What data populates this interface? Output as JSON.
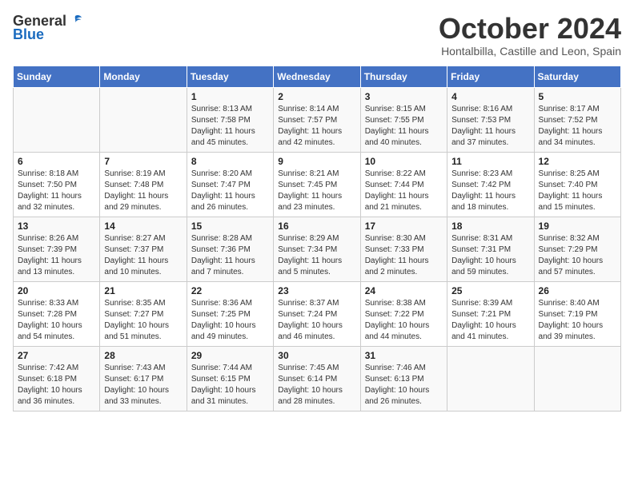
{
  "header": {
    "logo_general": "General",
    "logo_blue": "Blue",
    "month_title": "October 2024",
    "subtitle": "Hontalbilla, Castille and Leon, Spain"
  },
  "days_of_week": [
    "Sunday",
    "Monday",
    "Tuesday",
    "Wednesday",
    "Thursday",
    "Friday",
    "Saturday"
  ],
  "weeks": [
    [
      {
        "day": "",
        "info": ""
      },
      {
        "day": "",
        "info": ""
      },
      {
        "day": "1",
        "info": "Sunrise: 8:13 AM\nSunset: 7:58 PM\nDaylight: 11 hours and 45 minutes."
      },
      {
        "day": "2",
        "info": "Sunrise: 8:14 AM\nSunset: 7:57 PM\nDaylight: 11 hours and 42 minutes."
      },
      {
        "day": "3",
        "info": "Sunrise: 8:15 AM\nSunset: 7:55 PM\nDaylight: 11 hours and 40 minutes."
      },
      {
        "day": "4",
        "info": "Sunrise: 8:16 AM\nSunset: 7:53 PM\nDaylight: 11 hours and 37 minutes."
      },
      {
        "day": "5",
        "info": "Sunrise: 8:17 AM\nSunset: 7:52 PM\nDaylight: 11 hours and 34 minutes."
      }
    ],
    [
      {
        "day": "6",
        "info": "Sunrise: 8:18 AM\nSunset: 7:50 PM\nDaylight: 11 hours and 32 minutes."
      },
      {
        "day": "7",
        "info": "Sunrise: 8:19 AM\nSunset: 7:48 PM\nDaylight: 11 hours and 29 minutes."
      },
      {
        "day": "8",
        "info": "Sunrise: 8:20 AM\nSunset: 7:47 PM\nDaylight: 11 hours and 26 minutes."
      },
      {
        "day": "9",
        "info": "Sunrise: 8:21 AM\nSunset: 7:45 PM\nDaylight: 11 hours and 23 minutes."
      },
      {
        "day": "10",
        "info": "Sunrise: 8:22 AM\nSunset: 7:44 PM\nDaylight: 11 hours and 21 minutes."
      },
      {
        "day": "11",
        "info": "Sunrise: 8:23 AM\nSunset: 7:42 PM\nDaylight: 11 hours and 18 minutes."
      },
      {
        "day": "12",
        "info": "Sunrise: 8:25 AM\nSunset: 7:40 PM\nDaylight: 11 hours and 15 minutes."
      }
    ],
    [
      {
        "day": "13",
        "info": "Sunrise: 8:26 AM\nSunset: 7:39 PM\nDaylight: 11 hours and 13 minutes."
      },
      {
        "day": "14",
        "info": "Sunrise: 8:27 AM\nSunset: 7:37 PM\nDaylight: 11 hours and 10 minutes."
      },
      {
        "day": "15",
        "info": "Sunrise: 8:28 AM\nSunset: 7:36 PM\nDaylight: 11 hours and 7 minutes."
      },
      {
        "day": "16",
        "info": "Sunrise: 8:29 AM\nSunset: 7:34 PM\nDaylight: 11 hours and 5 minutes."
      },
      {
        "day": "17",
        "info": "Sunrise: 8:30 AM\nSunset: 7:33 PM\nDaylight: 11 hours and 2 minutes."
      },
      {
        "day": "18",
        "info": "Sunrise: 8:31 AM\nSunset: 7:31 PM\nDaylight: 10 hours and 59 minutes."
      },
      {
        "day": "19",
        "info": "Sunrise: 8:32 AM\nSunset: 7:29 PM\nDaylight: 10 hours and 57 minutes."
      }
    ],
    [
      {
        "day": "20",
        "info": "Sunrise: 8:33 AM\nSunset: 7:28 PM\nDaylight: 10 hours and 54 minutes."
      },
      {
        "day": "21",
        "info": "Sunrise: 8:35 AM\nSunset: 7:27 PM\nDaylight: 10 hours and 51 minutes."
      },
      {
        "day": "22",
        "info": "Sunrise: 8:36 AM\nSunset: 7:25 PM\nDaylight: 10 hours and 49 minutes."
      },
      {
        "day": "23",
        "info": "Sunrise: 8:37 AM\nSunset: 7:24 PM\nDaylight: 10 hours and 46 minutes."
      },
      {
        "day": "24",
        "info": "Sunrise: 8:38 AM\nSunset: 7:22 PM\nDaylight: 10 hours and 44 minutes."
      },
      {
        "day": "25",
        "info": "Sunrise: 8:39 AM\nSunset: 7:21 PM\nDaylight: 10 hours and 41 minutes."
      },
      {
        "day": "26",
        "info": "Sunrise: 8:40 AM\nSunset: 7:19 PM\nDaylight: 10 hours and 39 minutes."
      }
    ],
    [
      {
        "day": "27",
        "info": "Sunrise: 7:42 AM\nSunset: 6:18 PM\nDaylight: 10 hours and 36 minutes."
      },
      {
        "day": "28",
        "info": "Sunrise: 7:43 AM\nSunset: 6:17 PM\nDaylight: 10 hours and 33 minutes."
      },
      {
        "day": "29",
        "info": "Sunrise: 7:44 AM\nSunset: 6:15 PM\nDaylight: 10 hours and 31 minutes."
      },
      {
        "day": "30",
        "info": "Sunrise: 7:45 AM\nSunset: 6:14 PM\nDaylight: 10 hours and 28 minutes."
      },
      {
        "day": "31",
        "info": "Sunrise: 7:46 AM\nSunset: 6:13 PM\nDaylight: 10 hours and 26 minutes."
      },
      {
        "day": "",
        "info": ""
      },
      {
        "day": "",
        "info": ""
      }
    ]
  ]
}
